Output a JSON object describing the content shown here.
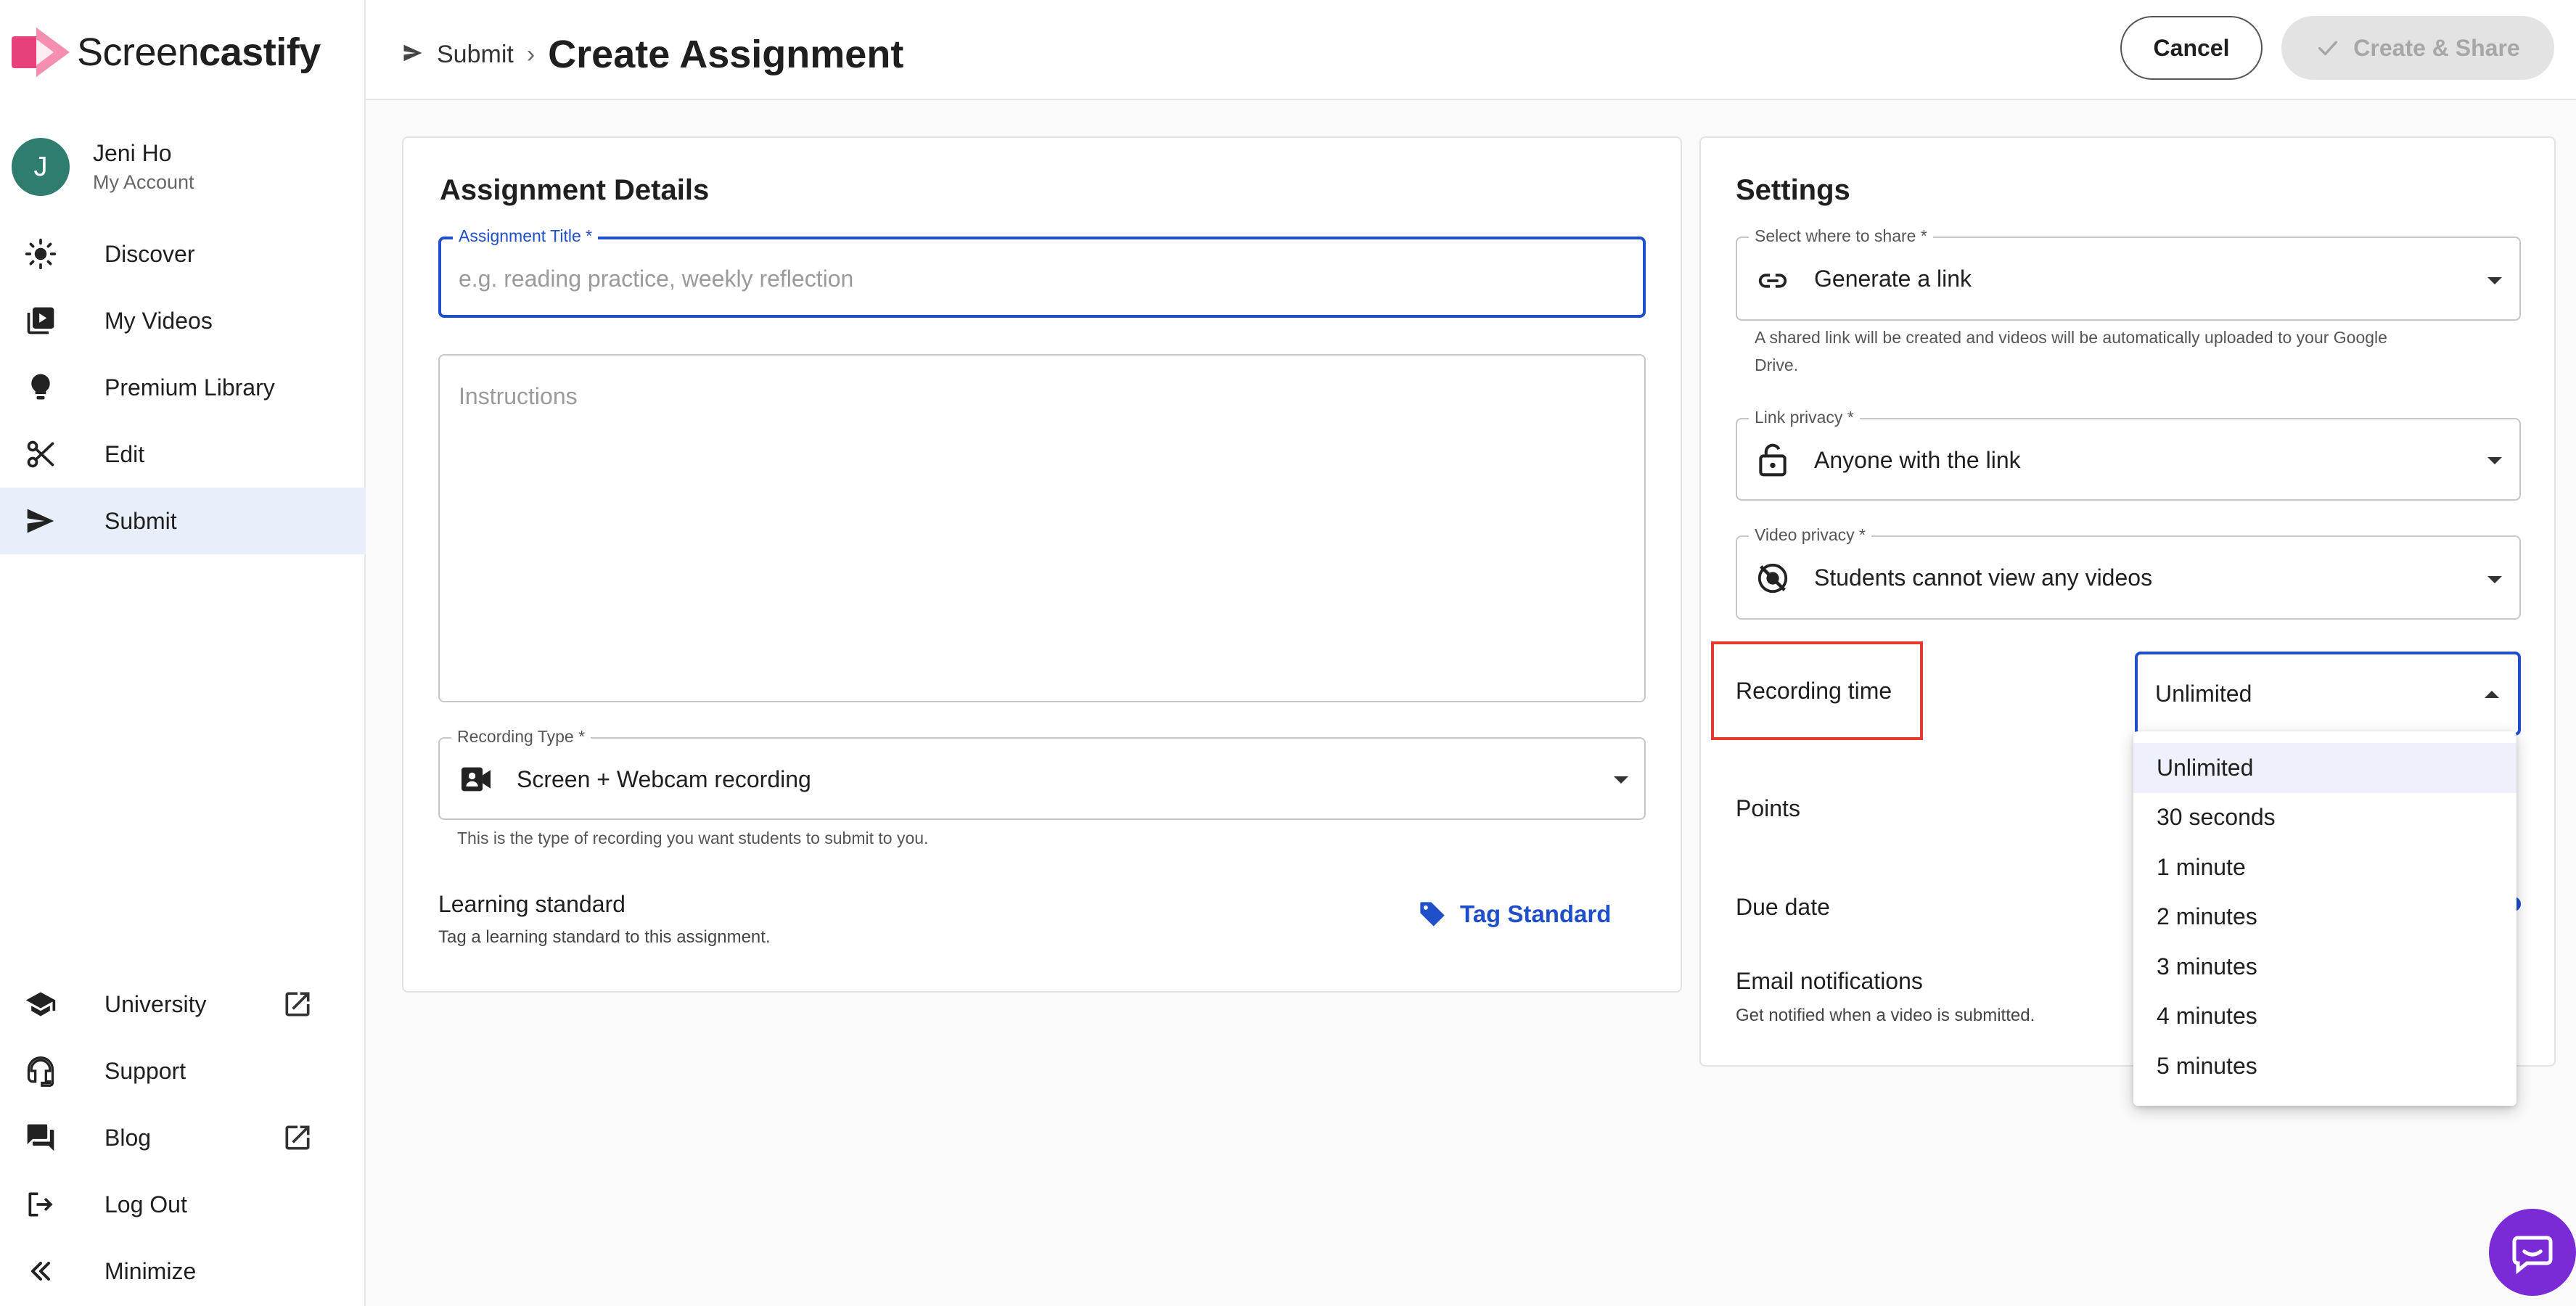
{
  "app": {
    "logo_light": "Screen",
    "logo_bold": "castify"
  },
  "account": {
    "initial": "J",
    "name": "Jeni Ho",
    "subtitle": "My Account"
  },
  "nav": {
    "top": [
      {
        "label": "Discover",
        "icon": "sun-icon"
      },
      {
        "label": "My Videos",
        "icon": "video-library-icon"
      },
      {
        "label": "Premium Library",
        "icon": "lightbulb-icon"
      },
      {
        "label": "Edit",
        "icon": "scissors-icon"
      },
      {
        "label": "Submit",
        "icon": "send-icon",
        "active": true
      }
    ],
    "bottom": [
      {
        "label": "University",
        "icon": "graduation-cap-icon",
        "external": true
      },
      {
        "label": "Support",
        "icon": "headset-icon"
      },
      {
        "label": "Blog",
        "icon": "forum-icon",
        "external": true
      },
      {
        "label": "Log Out",
        "icon": "logout-icon"
      },
      {
        "label": "Minimize",
        "icon": "double-chevron-left-icon"
      }
    ]
  },
  "header": {
    "breadcrumb": "Submit",
    "separator": "›",
    "title": "Create Assignment",
    "cancel_label": "Cancel",
    "create_label": "Create & Share"
  },
  "details": {
    "title": "Assignment Details",
    "assignment_title": {
      "label": "Assignment Title *",
      "placeholder": "e.g. reading practice, weekly reflection"
    },
    "instructions": {
      "placeholder": "Instructions"
    },
    "recording_type": {
      "label": "Recording Type *",
      "value": "Screen + Webcam recording",
      "helper": "This is the type of recording you want students to submit to you."
    },
    "learning_standard": {
      "label": "Learning standard",
      "sub": "Tag a learning standard to this assignment.",
      "button": "Tag Standard"
    }
  },
  "settings": {
    "title": "Settings",
    "share": {
      "label": "Select where to share *",
      "value": "Generate a link",
      "helper_line1": "A shared link will be created and videos will be automatically uploaded to your Google",
      "helper_line2": "Drive."
    },
    "link_privacy": {
      "label": "Link privacy *",
      "value": "Anyone with the link"
    },
    "video_privacy": {
      "label": "Video privacy *",
      "value": "Students cannot view any videos"
    },
    "recording_time": {
      "label": "Recording time",
      "value": "Unlimited",
      "options": [
        "Unlimited",
        "30 seconds",
        "1 minute",
        "2 minutes",
        "3 minutes",
        "4 minutes",
        "5 minutes"
      ]
    },
    "points": {
      "label": "Points"
    },
    "due_date": {
      "label": "Due date"
    },
    "email": {
      "label": "Email notifications",
      "sub": "Get notified when a video is submitted."
    }
  },
  "colors": {
    "accent": "#1f4fc9",
    "brand_pink": "#e8407a",
    "highlight": "#e23b2e",
    "chat": "#7b2bd6"
  }
}
